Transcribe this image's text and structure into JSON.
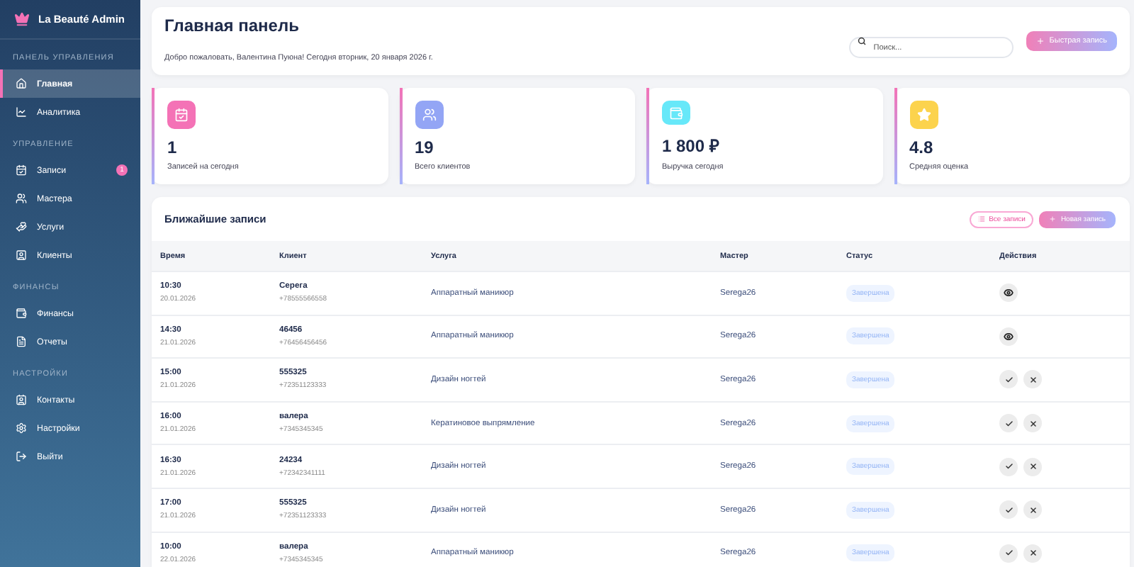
{
  "brand": {
    "title": "La Beauté Admin"
  },
  "sidebar": {
    "sections": [
      {
        "title": "ПАНЕЛЬ УПРАВЛЕНИЯ",
        "items": [
          {
            "label": "Главная",
            "selected": true
          },
          {
            "label": "Аналитика",
            "selected": false
          }
        ]
      },
      {
        "title": "УПРАВЛЕНИЕ",
        "items": [
          {
            "label": "Записи",
            "selected": false,
            "badge": "1"
          },
          {
            "label": "Мастера",
            "selected": false
          },
          {
            "label": "Услуги",
            "selected": false
          },
          {
            "label": "Клиенты",
            "selected": false
          }
        ]
      },
      {
        "title": "ФИНАНСЫ",
        "items": [
          {
            "label": "Финансы",
            "selected": false
          },
          {
            "label": "Отчеты",
            "selected": false
          }
        ]
      },
      {
        "title": "НАСТРОЙКИ",
        "items": [
          {
            "label": "Контакты",
            "selected": false
          },
          {
            "label": "Настройки",
            "selected": false
          },
          {
            "label": "Выйти",
            "selected": false
          }
        ]
      }
    ]
  },
  "header": {
    "title": "Главная панель",
    "subtitle": "Добро пожаловать, Валентина Пуюна! Сегодня вторник, 20 января 2026 г.",
    "search": {
      "placeholder": "Поиск..."
    },
    "quick_button": "Быстрая запись"
  },
  "stats": [
    {
      "value": "1",
      "label": "Записей на сегодня",
      "color": "#f472b6"
    },
    {
      "value": "19",
      "label": "Всего клиентов",
      "color": "#93a5f5"
    },
    {
      "value": "1 800 ₽",
      "label": "Выручка сегодня",
      "color": "#67e8f9"
    },
    {
      "value": "4.8",
      "label": "Средняя оценка",
      "color": "#fcd34d"
    }
  ],
  "appointments": {
    "title": "Ближайшие записи",
    "all_button": "Все записи",
    "new_button": "Новая запись",
    "columns": [
      "Время",
      "Клиент",
      "Услуга",
      "Мастер",
      "Статус",
      "Действия"
    ],
    "rows": [
      {
        "time": "10:30",
        "date": "20.01.2026",
        "client": "Серега",
        "phone": "+78555566558",
        "service": "Аппаратный маникюр",
        "master": "Serega26",
        "status": "Завершена",
        "actions": [
          {
            "kind": "view"
          }
        ]
      },
      {
        "time": "14:30",
        "date": "21.01.2026",
        "client": "46456",
        "phone": "+76456456456",
        "service": "Аппаратный маникюр",
        "master": "Serega26",
        "status": "Завершена",
        "actions": [
          {
            "kind": "view"
          }
        ]
      },
      {
        "time": "15:00",
        "date": "21.01.2026",
        "client": "555325",
        "phone": "+72351123333",
        "service": "Дизайн ногтей",
        "master": "Serega26",
        "status": "Завершена",
        "actions": [
          {
            "kind": "confirm"
          },
          {
            "kind": "cancel"
          }
        ]
      },
      {
        "time": "16:00",
        "date": "21.01.2026",
        "client": "валера",
        "phone": "+7345345345",
        "service": "Кератиновое выпрямление",
        "master": "Serega26",
        "status": "Завершена",
        "actions": [
          {
            "kind": "confirm"
          },
          {
            "kind": "cancel"
          }
        ]
      },
      {
        "time": "16:30",
        "date": "21.01.2026",
        "client": "24234",
        "phone": "+72342341111",
        "service": "Дизайн ногтей",
        "master": "Serega26",
        "status": "Завершена",
        "actions": [
          {
            "kind": "confirm"
          },
          {
            "kind": "cancel"
          }
        ]
      },
      {
        "time": "17:00",
        "date": "21.01.2026",
        "client": "555325",
        "phone": "+72351123333",
        "service": "Дизайн ногтей",
        "master": "Serega26",
        "status": "Завершена",
        "actions": [
          {
            "kind": "confirm"
          },
          {
            "kind": "cancel"
          }
        ]
      },
      {
        "time": "10:00",
        "date": "22.01.2026",
        "client": "валера",
        "phone": "+7345345345",
        "service": "Аппаратный маникюр",
        "master": "Serega26",
        "status": "Завершена",
        "actions": [
          {
            "kind": "confirm"
          },
          {
            "kind": "cancel"
          }
        ]
      }
    ]
  }
}
